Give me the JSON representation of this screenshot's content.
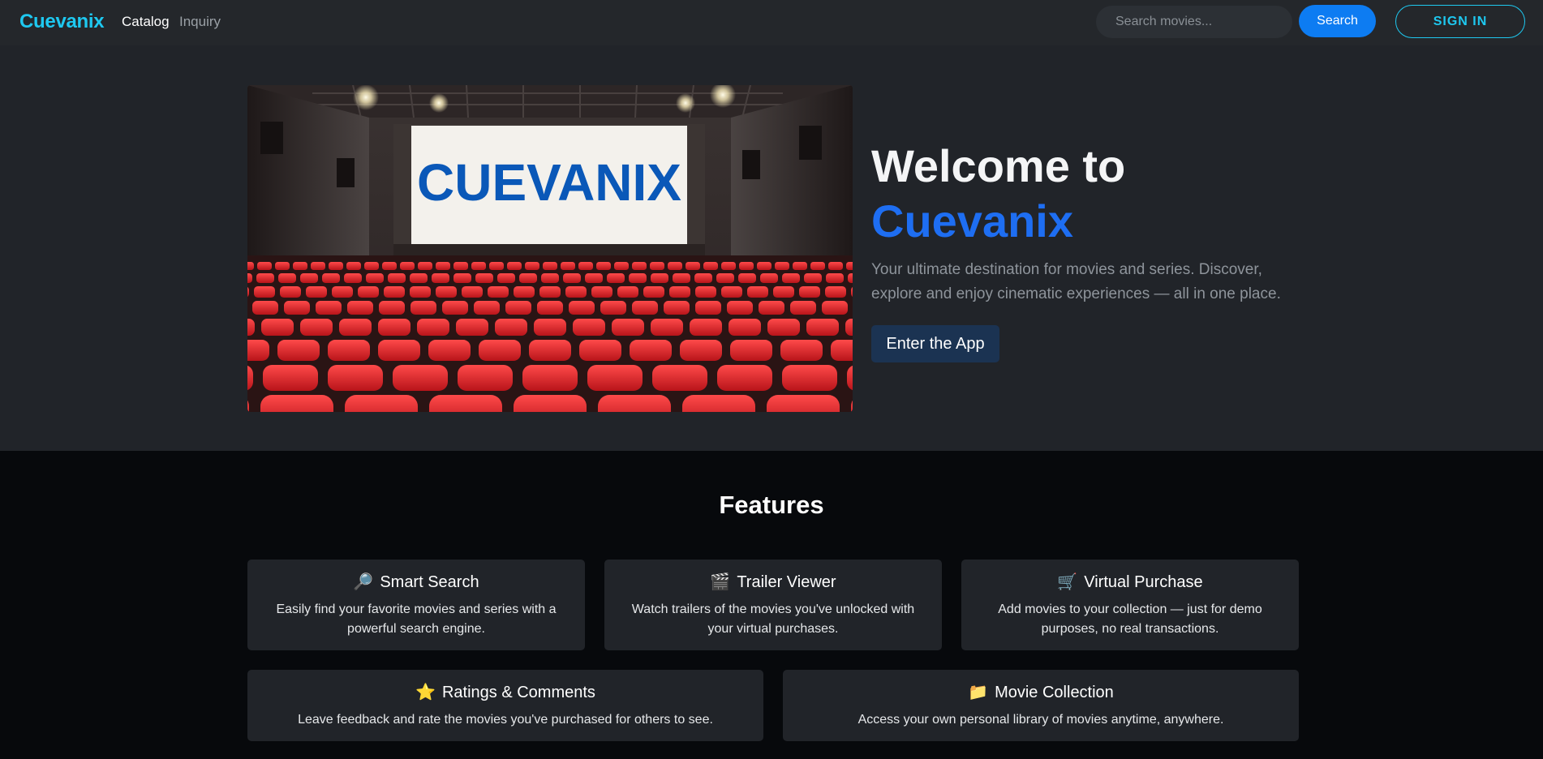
{
  "navbar": {
    "brand": "Cuevanix",
    "links": [
      "Catalog",
      "Inquiry"
    ],
    "search_placeholder": "Search movies...",
    "search_label": "Search",
    "signin_label": "SIGN IN"
  },
  "hero": {
    "image_text": "CUEVANIX",
    "title_prefix": "Welcome to",
    "title_accent": "Cuevanix",
    "subtitle": "Your ultimate destination for movies and series. Discover, explore and enjoy cinematic experiences — all in one place.",
    "cta_label": "Enter the App"
  },
  "features": {
    "heading": "Features",
    "items": [
      {
        "icon": "🔎",
        "icon_name": "magnifier-icon",
        "title": "Smart Search",
        "desc": "Easily find your favorite movies and series with a powerful search engine."
      },
      {
        "icon": "🎬",
        "icon_name": "clapperboard-icon",
        "title": "Trailer Viewer",
        "desc": "Watch trailers of the movies you've unlocked with your virtual purchases."
      },
      {
        "icon": "🛒",
        "icon_name": "cart-icon",
        "title": "Virtual Purchase",
        "desc": "Add movies to your collection — just for demo purposes, no real transactions."
      },
      {
        "icon": "⭐",
        "icon_name": "star-icon",
        "title": "Ratings & Comments",
        "desc": "Leave feedback and rate the movies you've purchased for others to see."
      },
      {
        "icon": "📁",
        "icon_name": "folder-icon",
        "title": "Movie Collection",
        "desc": "Access your own personal library of movies anytime, anywhere."
      }
    ]
  },
  "colors": {
    "brand": "#1ec8f0",
    "accent": "#1e6ef2",
    "search_button": "#0d7cf2",
    "hero_bg": "#212429",
    "page_bg": "#07090c"
  }
}
